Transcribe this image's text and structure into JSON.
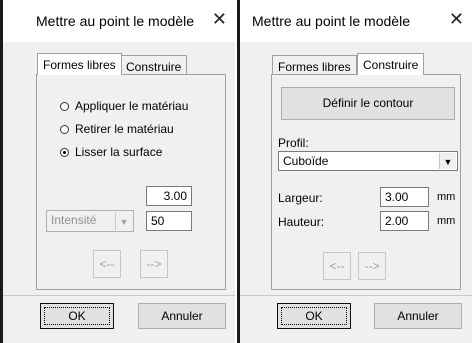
{
  "left_dialog": {
    "title": "Mettre au point le modèle",
    "close_glyph": "✕",
    "tabs": [
      "Formes libres",
      "Construire"
    ],
    "active_tab": "Formes libres",
    "options": [
      {
        "label": "Appliquer le matériau",
        "checked": false
      },
      {
        "label": "Retirer le matériau",
        "checked": false
      },
      {
        "label": "Lisser la surface",
        "checked": true
      }
    ],
    "value_field": "3.00",
    "intensity_select": "Intensité",
    "intensity_value": "50",
    "prev_label": "<--",
    "next_label": "-->",
    "ok_label": "OK",
    "cancel_label": "Annuler"
  },
  "right_dialog": {
    "title": "Mettre au point le modèle",
    "close_glyph": "✕",
    "tabs": [
      "Formes libres",
      "Construire"
    ],
    "active_tab": "Construire",
    "define_contour_label": "Définir le contour",
    "profile_label": "Profil:",
    "profile_value": "Cuboïde",
    "width_label": "Largeur:",
    "width_value": "3.00",
    "width_unit": "mm",
    "height_label": "Hauteur:",
    "height_value": "2.00",
    "height_unit": "mm",
    "prev_label": "<--",
    "next_label": "-->",
    "ok_label": "OK",
    "cancel_label": "Annuler"
  }
}
